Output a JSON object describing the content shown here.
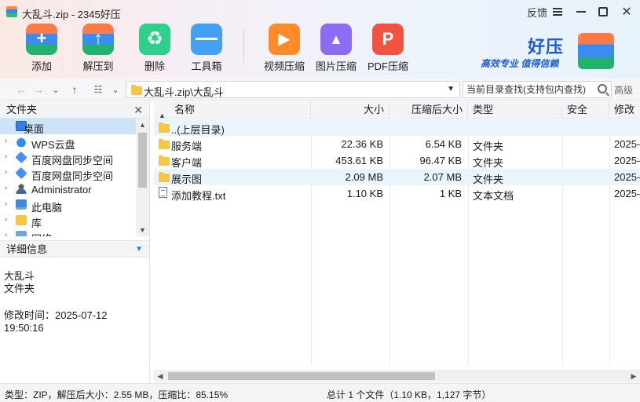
{
  "window": {
    "title": "大乱斗.zip - 2345好压",
    "feedback_label": "反馈"
  },
  "toolbar": {
    "add_label": "添加",
    "extract_label": "解压到",
    "delete_label": "删除",
    "tools_label": "工具箱",
    "video_label": "视频压缩",
    "image_label": "图片压缩",
    "pdf_label": "PDF压缩"
  },
  "brand": {
    "name": "好压",
    "slogan": "高效专业  值得信赖"
  },
  "address": {
    "path": "大乱斗.zip\\大乱斗",
    "search_placeholder": "当前目录查找(支持包内查找)",
    "advanced_label": "高级"
  },
  "left_pane": {
    "folder_header": "文件夹",
    "tree": [
      {
        "label": "桌面",
        "icon": "desktop-icon",
        "selected": true
      },
      {
        "label": "WPS云盘",
        "icon": "cloud-icon"
      },
      {
        "label": "百度网盘同步空间",
        "icon": "baidu-icon"
      },
      {
        "label": "百度网盘同步空间",
        "icon": "baidu-icon"
      },
      {
        "label": "Administrator",
        "icon": "user-icon"
      },
      {
        "label": "此电脑",
        "icon": "computer-icon"
      },
      {
        "label": "库",
        "icon": "library-icon"
      },
      {
        "label": "网络",
        "icon": "network-icon"
      }
    ],
    "detail_header": "详细信息",
    "detail": {
      "name": "大乱斗",
      "type": "文件夹",
      "modified": "修改时间：2025-07-12 19:50:16"
    }
  },
  "file_list": {
    "columns": {
      "name": "名称",
      "size": "大小",
      "packed": "压缩后大小",
      "type": "类型",
      "security": "安全",
      "modified": "修改时"
    },
    "rows": [
      {
        "name": "..(上层目录)",
        "size": "",
        "packed": "",
        "type": "",
        "modified": "",
        "kind": "folder"
      },
      {
        "name": "服务端",
        "size": "22.36 KB",
        "packed": "6.54 KB",
        "type": "文件夹",
        "modified": "2025-",
        "kind": "folder"
      },
      {
        "name": "客户端",
        "size": "453.61 KB",
        "packed": "96.47 KB",
        "type": "文件夹",
        "modified": "2025-",
        "kind": "folder"
      },
      {
        "name": "展示图",
        "size": "2.09 MB",
        "packed": "2.07 MB",
        "type": "文件夹",
        "modified": "2025-",
        "kind": "folder"
      },
      {
        "name": "添加教程.txt",
        "size": "1.10 KB",
        "packed": "1 KB",
        "type": "文本文档",
        "modified": "2025-",
        "kind": "text"
      }
    ]
  },
  "status": {
    "left": "类型：ZIP，解压后大小：2.55 MB，压缩比：85.15%",
    "right": "总计 1 个文件（1.10 KB，1,127 字节）"
  }
}
